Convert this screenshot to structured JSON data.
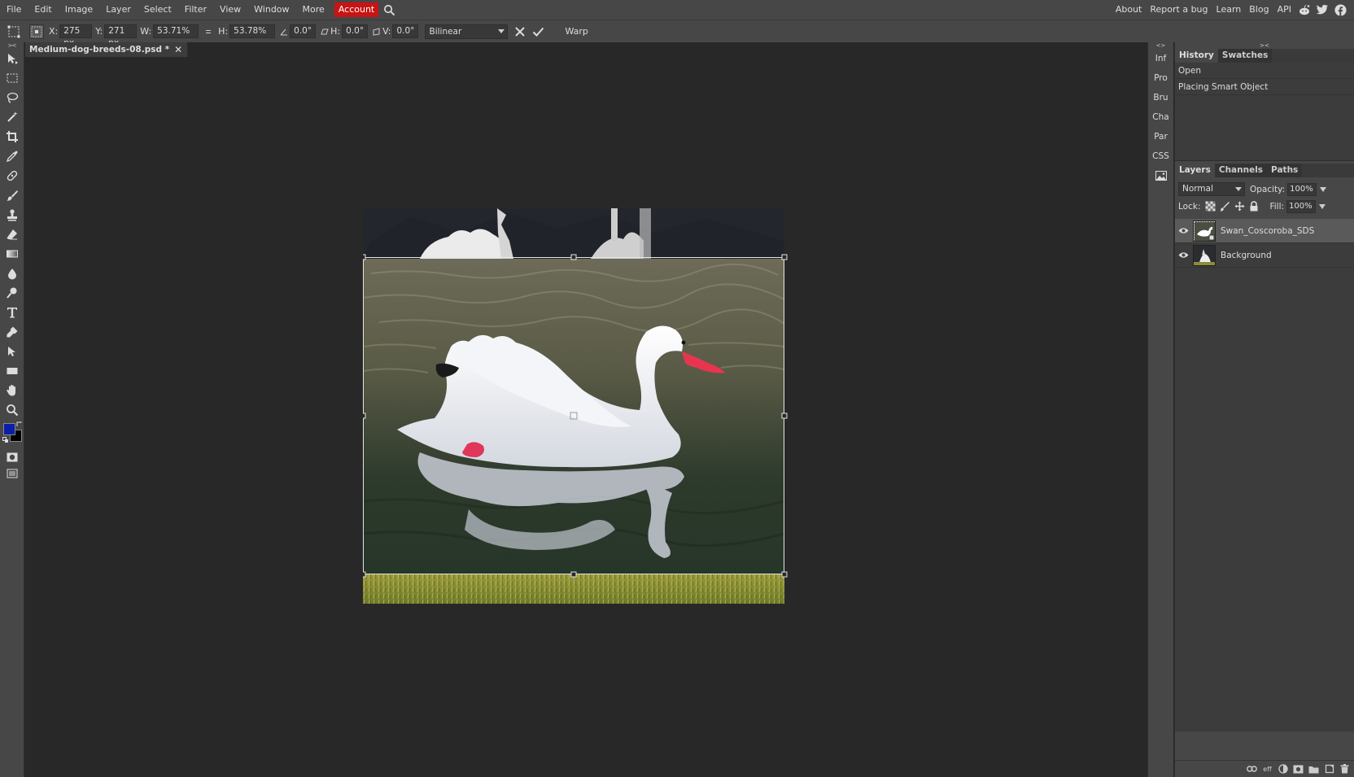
{
  "menu": {
    "items": [
      "File",
      "Edit",
      "Image",
      "Layer",
      "Select",
      "Filter",
      "View",
      "Window",
      "More"
    ],
    "account": "Account",
    "right_links": [
      "About",
      "Report a bug",
      "Learn",
      "Blog",
      "API"
    ]
  },
  "options": {
    "x_label": "X:",
    "x_value": "275 px",
    "y_label": "Y:",
    "y_value": "271 px",
    "w_label": "W:",
    "w_value": "53.71%",
    "h_label": "H:",
    "h_value": "53.78%",
    "angle_value": "0.0°",
    "hskew_label": "H:",
    "hskew_value": "0.0°",
    "vskew_label": "V:",
    "vskew_value": "0.0°",
    "interpolation": "Bilinear",
    "warp_label": "Warp"
  },
  "document": {
    "tab_title": "Medium-dog-breeds-08.psd *",
    "close_glyph": "✕"
  },
  "right_strip": {
    "items": [
      "Inf",
      "Pro",
      "Bru",
      "Cha",
      "Par",
      "CSS"
    ]
  },
  "history": {
    "tabs": [
      "History",
      "Swatches"
    ],
    "rows": [
      "Open",
      "Placing Smart Object"
    ]
  },
  "layers": {
    "tabs": [
      "Layers",
      "Channels",
      "Paths"
    ],
    "blend_mode": "Normal",
    "opacity_label": "Opacity:",
    "opacity_value": "100%",
    "lock_label": "Lock:",
    "fill_label": "Fill:",
    "fill_value": "100%",
    "rows": [
      {
        "name": "Swan_Coscoroba_SDS",
        "selected": true
      },
      {
        "name": "Background",
        "selected": false
      }
    ],
    "footer_icons": [
      "link-icon",
      "effects-icon",
      "adjustment-icon",
      "mask-icon",
      "folder-icon",
      "new-layer-icon",
      "trash-icon"
    ],
    "effects_text": "eff"
  },
  "colors": {
    "foreground": "#0b1ea8",
    "background": "#000000",
    "account_red": "#c81414"
  }
}
